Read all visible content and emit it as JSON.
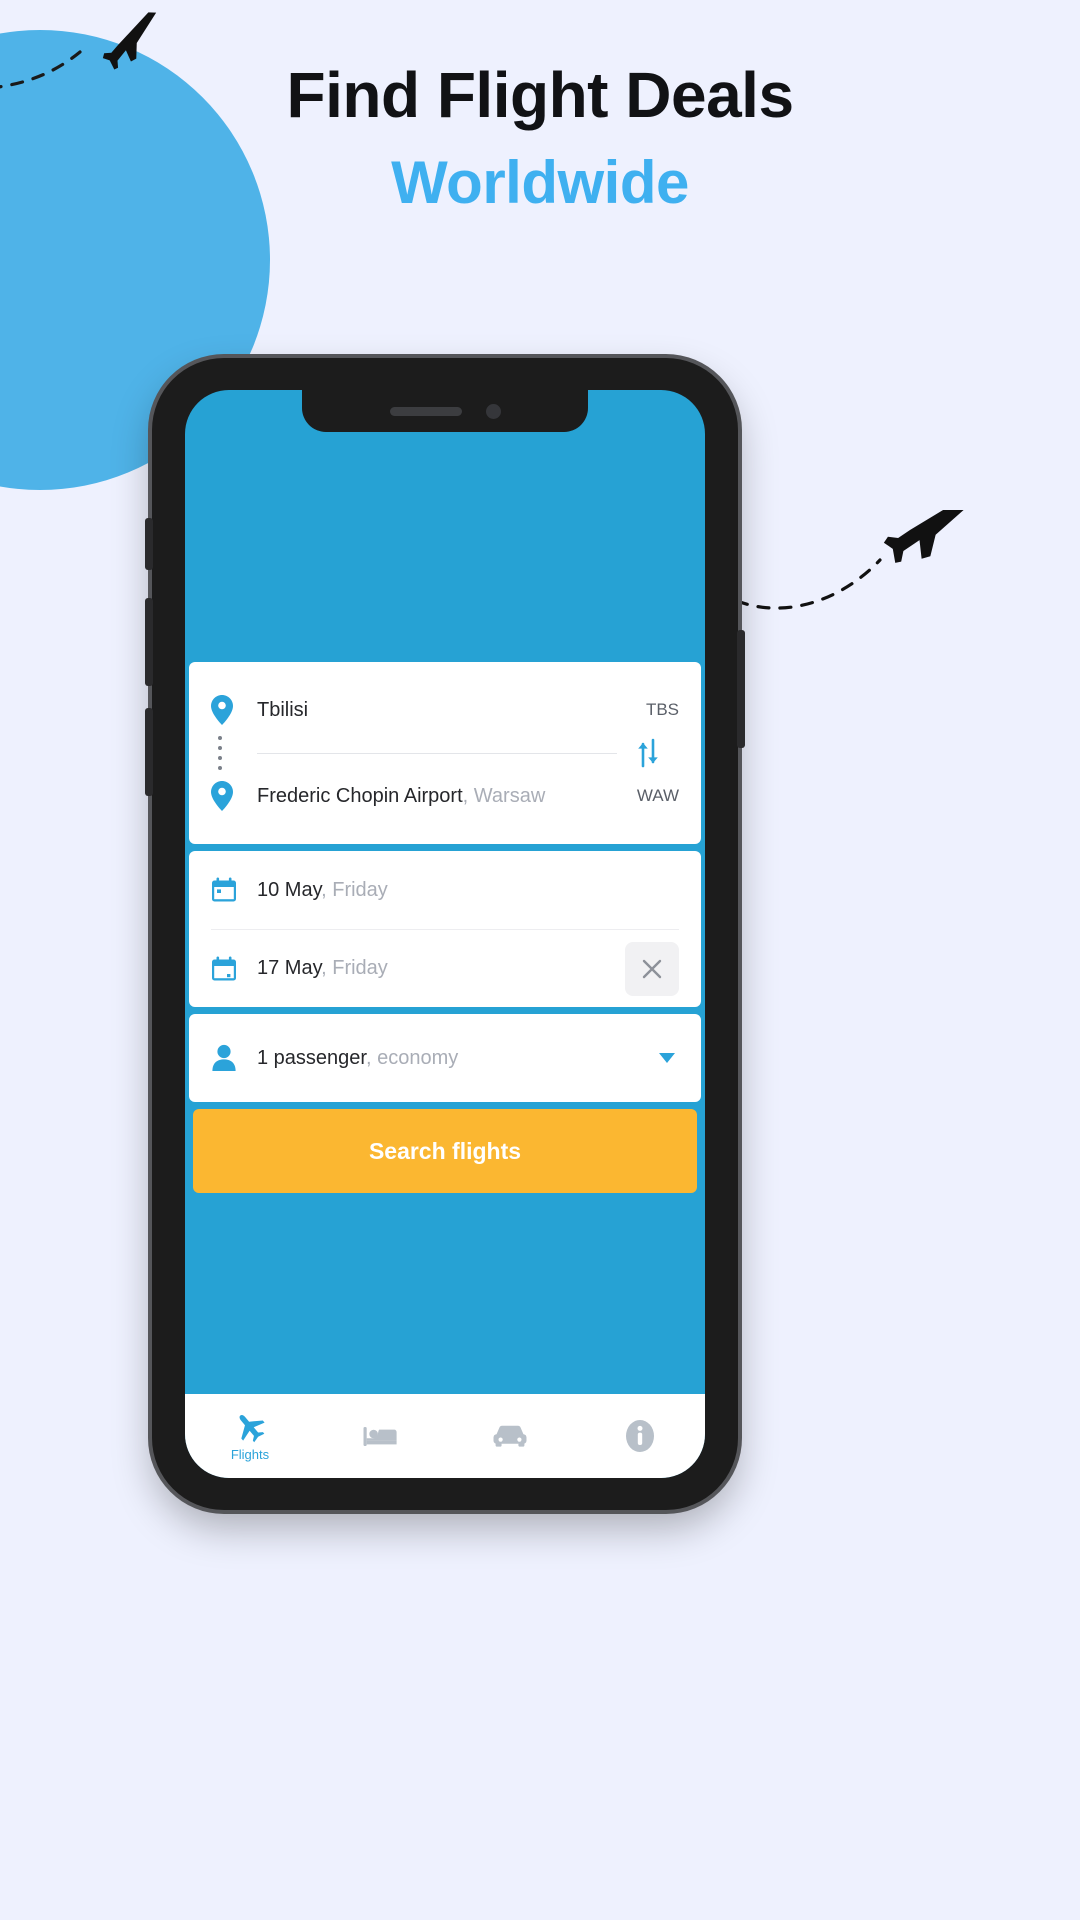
{
  "headline": {
    "line1": "Find Flight Deals",
    "line2": "Worldwide"
  },
  "colors": {
    "page_background": "#eef1fe",
    "brand_blue": "#26a2d4",
    "headline_accent": "#3fb0f0",
    "accent_orange": "#fbb731",
    "muted_text": "#a9adb6",
    "card_white": "#ffffff"
  },
  "phone": {
    "screen_background": "#26a2d4"
  },
  "search_form": {
    "route": {
      "origin": {
        "name": "Tbilisi",
        "city": "",
        "code": "TBS",
        "pin_icon": "map-pin-icon"
      },
      "destination": {
        "name": "Frederic Chopin Airport",
        "city": "Warsaw",
        "separator": ", ",
        "code": "WAW",
        "pin_icon": "map-pin-icon"
      },
      "swap_icon": "swap-vertical-arrows-icon"
    },
    "dates": {
      "depart": {
        "date": "10 May",
        "separator": ", ",
        "weekday": "Friday",
        "icon": "calendar-icon"
      },
      "return": {
        "date": "17 May",
        "separator": ", ",
        "weekday": "Friday",
        "icon": "calendar-icon",
        "clear_icon": "close-x-icon"
      }
    },
    "passengers": {
      "count_label": "1 passenger",
      "separator": ", ",
      "cabin_class": "economy",
      "icon": "person-icon",
      "dropdown_icon": "chevron-down-icon"
    },
    "submit": {
      "label": "Search flights"
    }
  },
  "bottom_nav": {
    "items": [
      {
        "label": "Flights",
        "icon": "airplane-icon",
        "active": true
      },
      {
        "label": "",
        "icon": "hotel-bed-icon",
        "active": false
      },
      {
        "label": "",
        "icon": "car-rental-icon",
        "active": false
      },
      {
        "label": "",
        "icon": "info-circle-icon",
        "active": false
      }
    ]
  },
  "decorations": {
    "top_left_plane": "airplane-dashed-trail-icon",
    "right_plane": "airplane-dashed-trail-icon",
    "circle": "background-circle"
  }
}
